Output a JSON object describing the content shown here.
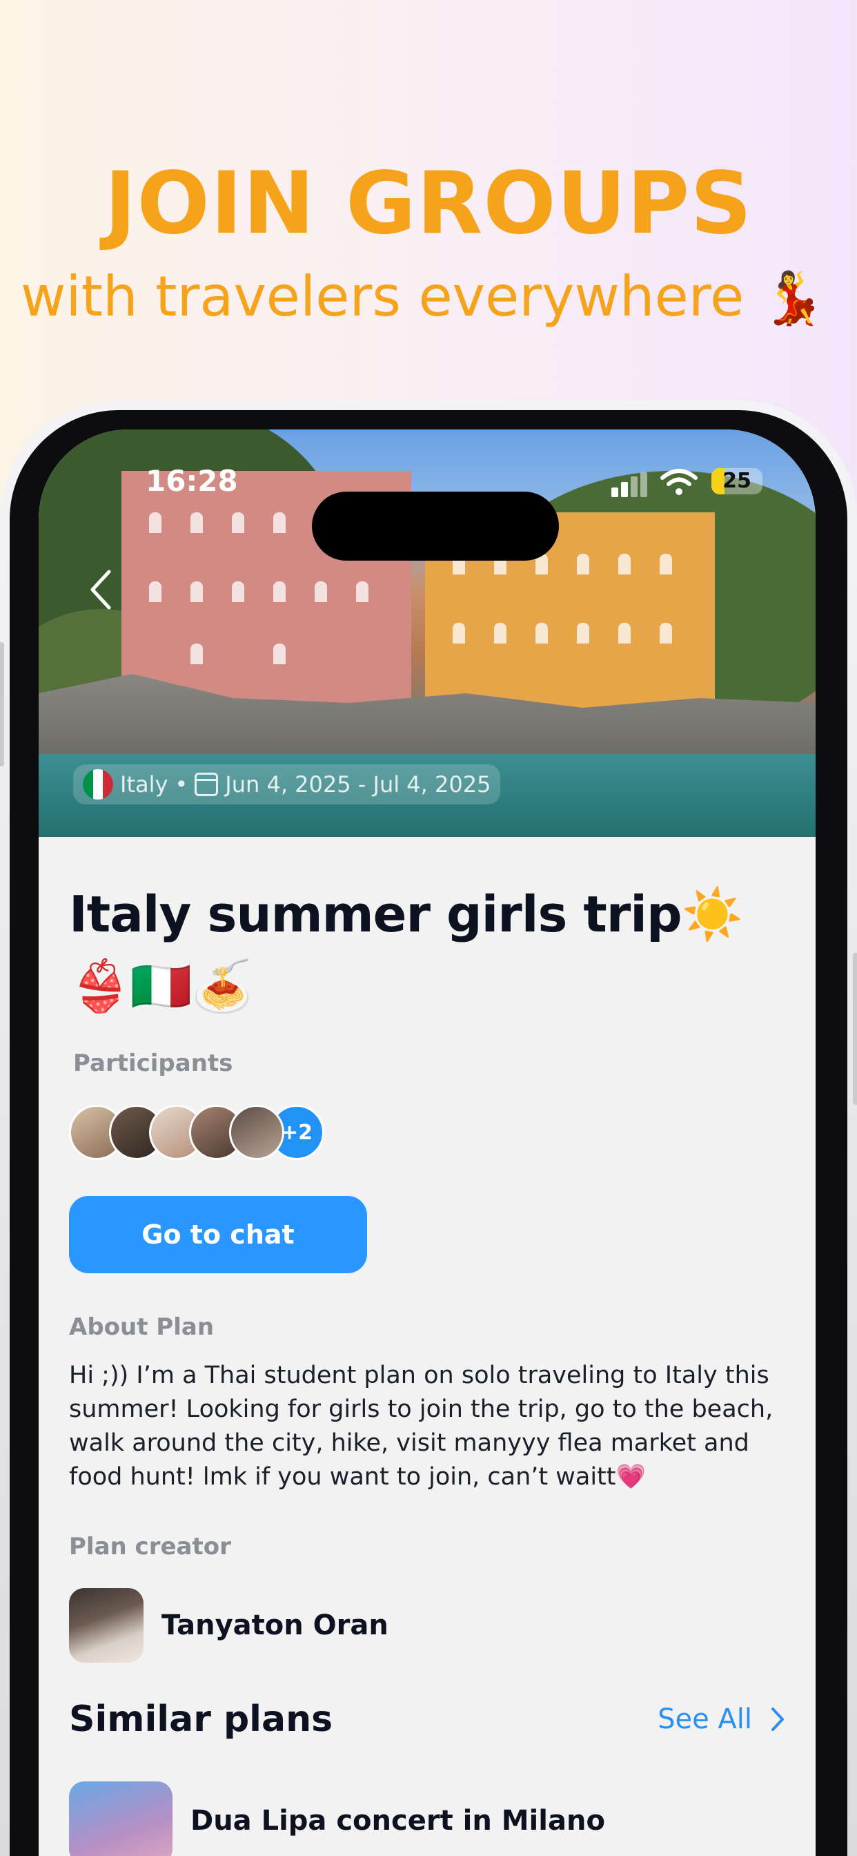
{
  "promo": {
    "title": "JOIN GROUPS",
    "subtitle": "with travelers everywhere",
    "emoji": "💃"
  },
  "status_bar": {
    "time": "16:28",
    "battery": "25"
  },
  "hero": {
    "country": "Italy",
    "separator": "•",
    "dates": "Jun 4, 2025 - Jul 4, 2025",
    "back_icon": "chevron-left-icon"
  },
  "plan": {
    "title": "Italy summer girls trip☀️👙🇮🇹🍝",
    "participants_label": "Participants",
    "participants_more": "+2",
    "chat_button": "Go to chat",
    "about_label": "About Plan",
    "about_text": "Hi ;)) I’m a Thai student plan on solo traveling to Italy this summer! Looking for girls to join the trip, go to the beach, walk around the city, hike, visit manyyy flea market and food hunt! lmk if you want to join, can’t waitt💗",
    "creator_label": "Plan creator",
    "creator_name": "Tanyaton Oran"
  },
  "similar": {
    "title": "Similar plans",
    "see_all": "See All",
    "items": [
      {
        "name": "Dua Lipa concert in Milano"
      }
    ]
  },
  "colors": {
    "accent_orange": "#f6a31c",
    "button_blue": "#2997ff",
    "link_blue": "#2b8ff0",
    "battery_yellow": "#f7d21a"
  }
}
